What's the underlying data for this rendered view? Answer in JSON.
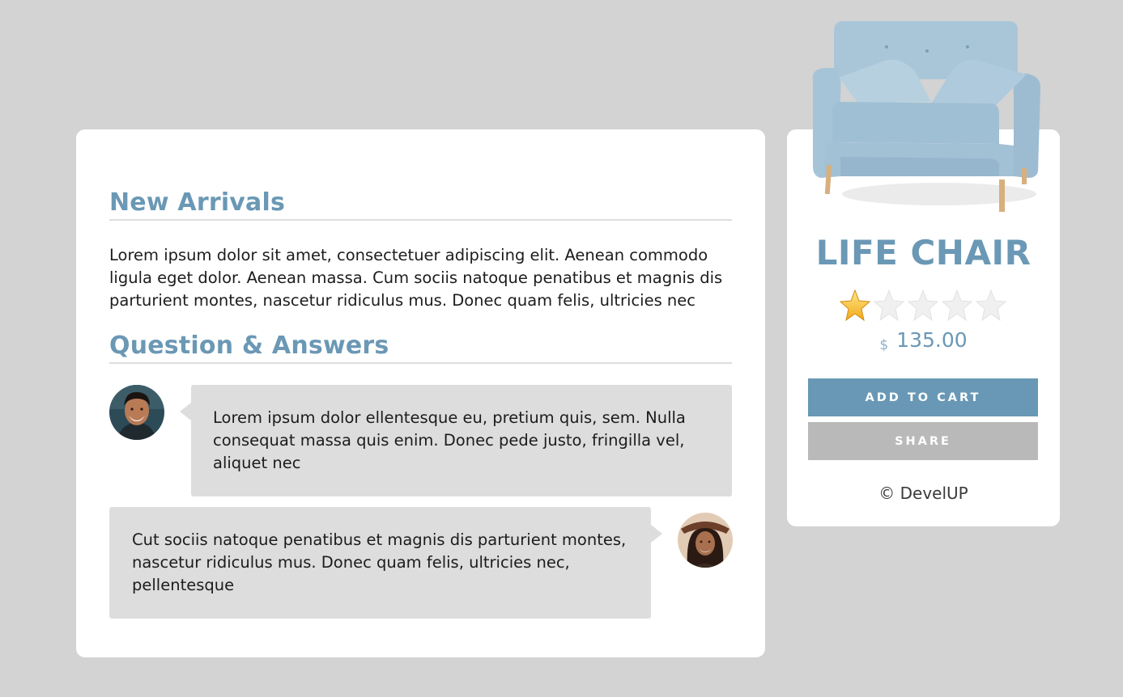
{
  "main": {
    "section1_title": "New Arrivals",
    "section1_text": "Lorem ipsum dolor sit amet, consectetuer adipiscing elit. Aenean commodo ligula eget dolor. Aenean massa. Cum sociis natoque penatibus et magnis dis parturient montes, nascetur ridiculus mus. Donec quam felis, ultricies nec",
    "section2_title": "Question & Answers",
    "qa": [
      {
        "text": "Lorem ipsum dolor ellentesque eu, pretium quis, sem. Nulla consequat massa quis enim. Donec pede justo, fringilla vel, aliquet nec",
        "avatar": "man-avatar"
      },
      {
        "text": "Cut sociis natoque penatibus et magnis dis parturient montes, nascetur ridiculus mus. Donec quam felis, ultricies nec, pellentesque",
        "avatar": "woman-avatar"
      }
    ]
  },
  "product": {
    "name": "LIFE CHAIR",
    "rating": 1,
    "rating_max": 5,
    "currency": "$",
    "price": "135.00",
    "add_to_cart": "ADD TO CART",
    "share": "SHARE",
    "footer": "© DevelUP"
  },
  "colors": {
    "accent": "#6898b5",
    "background": "#d3d3d3",
    "bubble": "#dddddd",
    "share_button": "#b9b9b9"
  }
}
